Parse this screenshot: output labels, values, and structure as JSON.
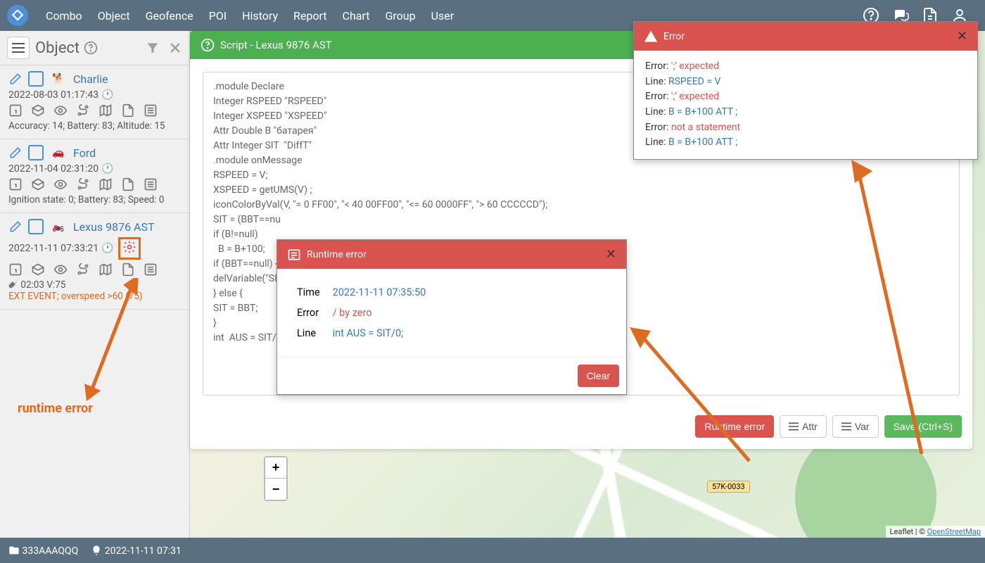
{
  "nav": [
    "Combo",
    "Object",
    "Geofence",
    "POI",
    "History",
    "Report",
    "Chart",
    "Group",
    "User"
  ],
  "sidebar": {
    "title": "Object",
    "items": [
      {
        "name": "Charlie",
        "icon": "dog",
        "ts": "2022-08-03 01:17:43",
        "info": "Accuracy: 14; Battery: 83; Altitude: 15"
      },
      {
        "name": "Ford",
        "icon": "car",
        "ts": "2022-11-04 02:31:20",
        "info": "Ignition state: 0; Battery: 83; Speed: 0"
      },
      {
        "name": "Lexus 9876 AST",
        "icon": "moto",
        "ts": "2022-11-11 07:33:21",
        "key": "02:03 V:75",
        "event": "EXT EVENT; overspeed >60 (75)"
      }
    ]
  },
  "script": {
    "header": "Script - Lexus 9876 AST",
    "code": ".module Declare\nInteger RSPEED \"RSPEED\"\nInteger XSPEED \"XSPEED\"\nAttr Double B \"батарея\"\nAttr Integer SIT  \"DiffT\"\n.module onMessage\nRSPEED = V;\nXSPEED = getUMS(V) ;\niconColorByVal(V, \"= 0 FF00\", \"< 40 00FF00\", \"<= 60 0000FF\", \"> 60 CCCCCD\");\nSIT = (BBT==nu\nif (B!=null)\n  B = B+100;\nif (BBT==null) {\ndelVariable(\"SIT\n} else {\nSIT = BBT;\n}\nint  AUS = SIT/0",
    "buttons": {
      "runtime": "Runtime error",
      "attr": "Attr",
      "var": "Var",
      "save": "Save (Ctrl+S)"
    }
  },
  "dlg_runtime": {
    "title": "Runtime error",
    "time_label": "Time",
    "time": "2022-11-11 07:35:50",
    "error_label": "Error",
    "error": "/ by zero",
    "line_label": "Line",
    "line": "int AUS = SIT/0;",
    "clear": "Clear"
  },
  "dlg_error": {
    "title": "Error",
    "lines": [
      {
        "k": "Error:",
        "v": "';' expected",
        "cls": "err-v"
      },
      {
        "k": "Line:",
        "v": "RSPEED = V",
        "cls": "line-v"
      },
      {
        "k": "Error:",
        "v": "';' expected",
        "cls": "err-v"
      },
      {
        "k": "Line:",
        "v": "B = B+100 ATT ;",
        "cls": "line-v"
      },
      {
        "k": "Error:",
        "v": "not a statement",
        "cls": "err-v"
      },
      {
        "k": "Line:",
        "v": "B = B+100 ATT ;",
        "cls": "line-v"
      }
    ]
  },
  "marker": "57K-0033",
  "attrib": {
    "leaflet": "Leaflet",
    "sep": " | © ",
    "osm": "OpenStreetMap"
  },
  "bottom": {
    "folder": "333AAAQQQ",
    "time": "2022-11-11 07:31"
  },
  "ann": {
    "label": "runtime error"
  }
}
